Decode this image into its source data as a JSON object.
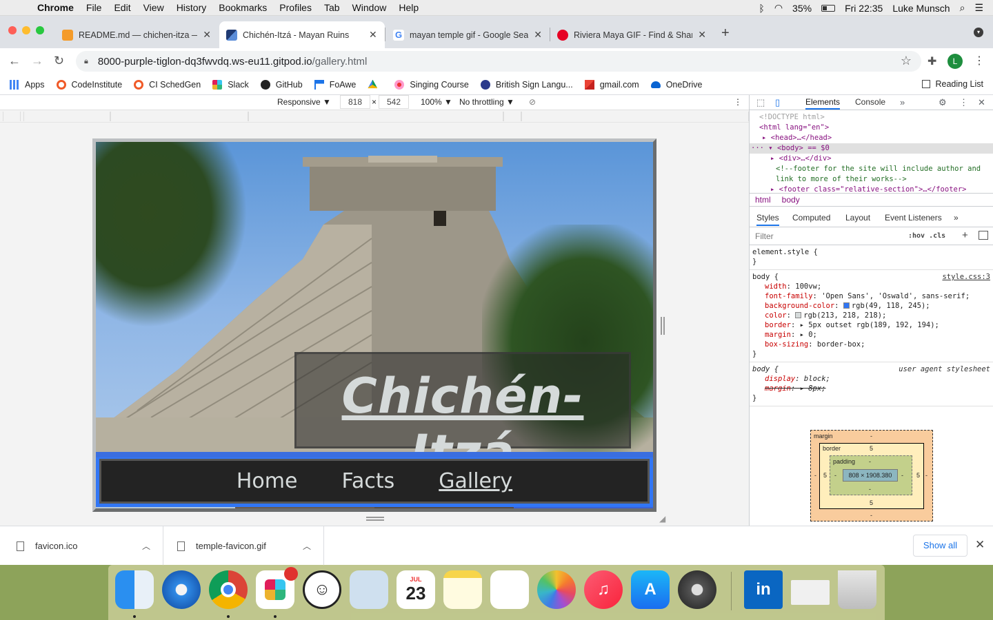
{
  "menubar": {
    "app": "Chrome",
    "items": [
      "File",
      "Edit",
      "View",
      "History",
      "Bookmarks",
      "Profiles",
      "Tab",
      "Window",
      "Help"
    ],
    "battery": "35%",
    "clock": "Fri 22:35",
    "user": "Luke Munsch"
  },
  "tabs": [
    {
      "title": "README.md — chichen-itza — ",
      "active": false
    },
    {
      "title": "Chichén-Itzá - Mayan Ruins",
      "active": true
    },
    {
      "title": "mayan temple gif - Google Sea",
      "active": false
    },
    {
      "title": "Riviera Maya GIF - Find & Shar",
      "active": false
    }
  ],
  "omnibox": {
    "host": "8000-purple-tiglon-dq3fwvdq.ws-eu11.gitpod.io",
    "path": "/gallery.html"
  },
  "profile_initial": "L",
  "bookmarks": [
    "Apps",
    "CodeInstitute",
    "CI SchedGen",
    "Slack",
    "GitHub",
    "FoAwe",
    "",
    "Singing Course",
    "British Sign Langu...",
    "gmail.com",
    "OneDrive"
  ],
  "reading_list": "Reading List",
  "device_toolbar": {
    "mode": "Responsive ▼",
    "width": "818",
    "times": "×",
    "height": "542",
    "zoom": "100% ▼",
    "throttle": "No throttling ▼"
  },
  "page": {
    "title": "Chichén-Itzá",
    "nav": [
      "Home",
      "Facts",
      "Gallery"
    ],
    "current_nav": "Gallery"
  },
  "devtools": {
    "tabs": [
      "Elements",
      "Console"
    ],
    "dom": {
      "doctype": "<!DOCTYPE html>",
      "html_open": "<html lang=\"en\">",
      "head": "<head>…</head>",
      "body": "<body> == $0",
      "div": "<div>…</div>",
      "comment": "<!--footer for the site will include author and link to more of their works-->",
      "footer": "<footer class=\"relative-section\">…</footer>"
    },
    "breadcrumbs": [
      "html",
      "body"
    ],
    "style_tabs": [
      "Styles",
      "Computed",
      "Layout",
      "Event Listeners"
    ],
    "filter_placeholder": "Filter",
    "hov_cls": ":hov  .cls",
    "rules": {
      "element_style": "element.style {",
      "close": "}",
      "body_selector": "body {",
      "body_source": "style.css:3",
      "props": [
        {
          "name": "width",
          "value": "100vw;"
        },
        {
          "name": "font-family",
          "value": "'Open Sans', 'Oswald', sans-serif;"
        },
        {
          "name": "background-color",
          "value": "rgb(49, 118, 245);"
        },
        {
          "name": "color",
          "value": "rgb(213, 218, 218);"
        },
        {
          "name": "border",
          "value": "▸ 5px outset  rgb(189, 192, 194);"
        },
        {
          "name": "margin",
          "value": "▸ 0;"
        },
        {
          "name": "box-sizing",
          "value": "border-box;"
        }
      ],
      "ua_selector": "body {",
      "ua_source": "user agent stylesheet",
      "ua_props": [
        {
          "name": "display",
          "value": "block;"
        },
        {
          "name": "margin",
          "value": "▸ 8px;"
        }
      ]
    },
    "box_model": {
      "margin_label": "margin",
      "margin_value": "-",
      "border_label": "border",
      "border_value": "5",
      "padding_label": "padding",
      "padding_value": "-",
      "content": "808 × 1908.380",
      "side_border": "5",
      "side_padding": "-",
      "bottom_padding": "-",
      "bottom_border": "5",
      "bottom_margin": "-"
    }
  },
  "downloads": [
    "favicon.ico",
    "temple-favicon.gif"
  ],
  "show_all": "Show all",
  "dock": {
    "calendar_month": "JUL",
    "calendar_day": "23"
  },
  "colors": {
    "site_bg": "#3176f5",
    "site_text": "#d5dada",
    "chrome_accent": "#1a73e8"
  }
}
